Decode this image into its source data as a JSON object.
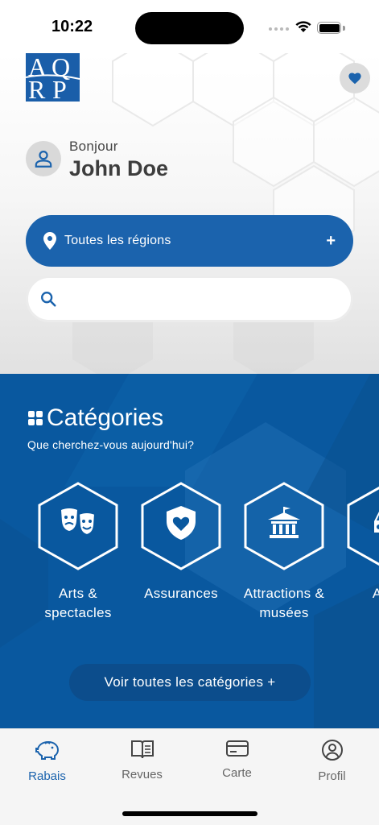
{
  "status_bar": {
    "time": "10:22"
  },
  "header": {
    "logo_letters": [
      "A",
      "Q",
      "R",
      "P"
    ],
    "greeting": "Bonjour",
    "user_name": "John Doe"
  },
  "region_selector": {
    "label": "Toutes les régions",
    "action": "+"
  },
  "search": {
    "value": "",
    "placeholder": ""
  },
  "categories": {
    "title": "Catégories",
    "subtitle": "Que cherchez-vous aujourd'hui?",
    "items": [
      {
        "label": "Arts & spectacles",
        "icon": "theater-masks-icon"
      },
      {
        "label": "Assurances",
        "icon": "heart-shield-icon"
      },
      {
        "label": "Attractions & musées",
        "icon": "museum-icon"
      },
      {
        "label": "Auto",
        "icon": "car-icon"
      }
    ],
    "see_all_label": "Voir toutes les catégories +"
  },
  "tab_bar": {
    "active": "Rabais",
    "tabs": [
      {
        "label": "Rabais",
        "icon": "piggy-bank-icon"
      },
      {
        "label": "Revues",
        "icon": "open-book-icon"
      },
      {
        "label": "Carte",
        "icon": "card-icon"
      },
      {
        "label": "Profil",
        "icon": "profile-icon"
      }
    ]
  },
  "colors": {
    "primary": "#1b63ad",
    "categories_bg": "#09589f",
    "see_all_bg": "#0c4d8c",
    "tab_active": "#1b63ad",
    "tab_inactive": "#666666"
  }
}
